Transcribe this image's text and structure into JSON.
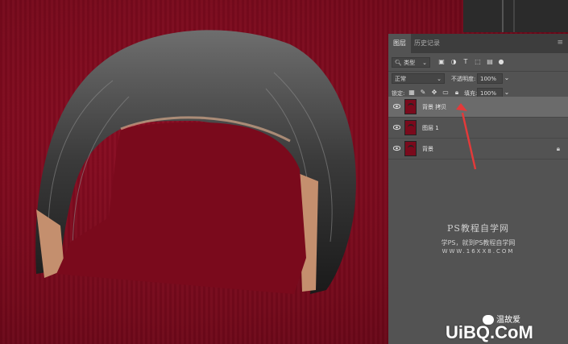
{
  "panel": {
    "tabs": [
      "图层",
      "历史记录"
    ],
    "menu_icon": "panel-menu-icon",
    "filter": {
      "kind": "类型",
      "icons": [
        "image-filter-icon",
        "adjustment-filter-icon",
        "text-filter-icon",
        "shape-filter-icon",
        "smart-object-filter-icon"
      ]
    },
    "blend_mode": "正常",
    "opacity_label": "不透明度:",
    "opacity_value": "100%",
    "lock_label": "锁定:",
    "fill_label": "填充:",
    "fill_value": "100%",
    "layers": [
      {
        "name": "背景 拷贝",
        "selected": true,
        "visible": true,
        "locked": false
      },
      {
        "name": "图层 1",
        "selected": false,
        "visible": true,
        "locked": false
      },
      {
        "name": "背景",
        "selected": false,
        "visible": true,
        "locked": true
      }
    ]
  },
  "watermark": {
    "line1": "PS教程自学网",
    "line2": "学PS，就到PS教程自学网",
    "line3": "WWW.16XX8.COM"
  },
  "wechat_text": "温故爱",
  "logo_text": "UiBQ.CoM",
  "colors": {
    "canvas": "#7a0a1c",
    "panel": "#535353",
    "arrow": "#e23a3a"
  }
}
